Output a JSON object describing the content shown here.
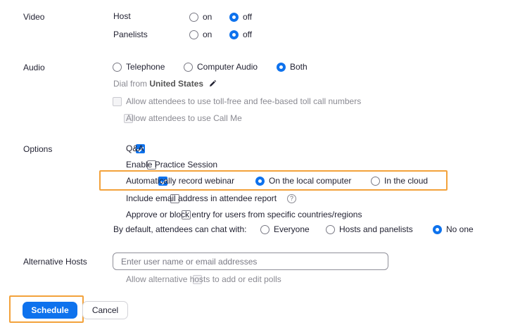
{
  "video": {
    "label": "Video",
    "host_label": "Host",
    "panelists_label": "Panelists",
    "on_label": "on",
    "off_label": "off",
    "host_value": "off",
    "panelists_value": "off"
  },
  "audio": {
    "label": "Audio",
    "options": [
      "Telephone",
      "Computer Audio",
      "Both"
    ],
    "selected": "Both",
    "dial_from_prefix": "Dial from",
    "dial_from_country": "United States",
    "toll_free_label": "Allow attendees to use toll-free and fee-based toll call numbers",
    "call_me_label": "Allow attendees to use Call Me"
  },
  "options": {
    "label": "Options",
    "qa_label": "Q&A",
    "qa_checked": true,
    "practice_label": "Enable Practice Session",
    "practice_checked": false,
    "auto_record_label": "Automatically record webinar",
    "auto_record_checked": true,
    "record_local_label": "On the local computer",
    "record_cloud_label": "In the cloud",
    "record_location": "On the local computer",
    "email_label": "Include email address in attendee report",
    "email_checked": false,
    "approve_block_label": "Approve or block entry for users from specific countries/regions",
    "approve_block_checked": false,
    "chat_label": "By default, attendees can chat with:",
    "chat_options": [
      "Everyone",
      "Hosts and panelists",
      "No one"
    ],
    "chat_selected": "No one",
    "help_glyph": "?"
  },
  "alternative_hosts": {
    "label": "Alternative Hosts",
    "placeholder": "Enter user name or email addresses",
    "polls_label": "Allow alternative hosts to add or edit polls"
  },
  "actions": {
    "schedule_label": "Schedule",
    "cancel_label": "Cancel"
  },
  "colors": {
    "accent": "#0e72ed",
    "highlight": "#f3a23b"
  },
  "icons": {
    "edit": "pencil-icon",
    "help": "question-circle-icon"
  }
}
